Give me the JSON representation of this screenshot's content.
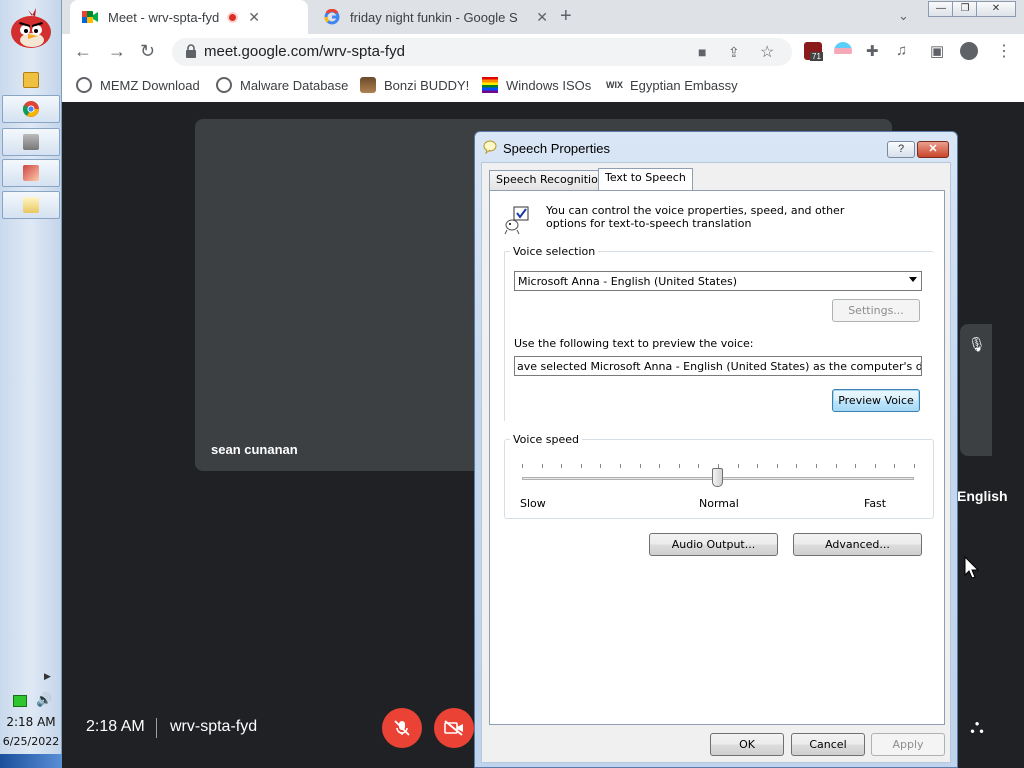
{
  "taskbar": {
    "time": "2:18 AM",
    "date": "6/25/2022"
  },
  "browser": {
    "tabs": [
      {
        "title": "Meet - wrv-spta-fyd",
        "active": true,
        "recording": true
      },
      {
        "title": "friday night funkin - Google S",
        "active": false
      }
    ],
    "url": "meet.google.com/wrv-spta-fyd",
    "extension_badge": "71",
    "bookmarks": [
      {
        "label": "MEMZ Download",
        "icon": "globe-icon"
      },
      {
        "label": "Malware Database",
        "icon": "globe-icon"
      },
      {
        "label": "Bonzi BUDDY!",
        "icon": "bonzi-icon"
      },
      {
        "label": "Windows ISOs",
        "icon": "rainbow-icon"
      },
      {
        "label": "Egyptian Embassy",
        "icon": "wix-icon"
      }
    ]
  },
  "meet": {
    "participant_name": "sean cunanan",
    "caption_fragment": "English",
    "time": "2:18 AM",
    "meeting_code": "wrv-spta-fyd"
  },
  "dialog": {
    "title": "Speech Properties",
    "help_label": "?",
    "close_label": "✕",
    "tabs": [
      "Speech Recognition",
      "Text to Speech"
    ],
    "active_tab": "Text to Speech",
    "intro_text": "You can control the voice properties, speed, and other options for text-to-speech translation",
    "voice_selection_label": "Voice selection",
    "selected_voice": "Microsoft Anna - English (United States)",
    "settings_button": "Settings...",
    "preview_label": "Use the following text to preview the voice:",
    "preview_text": "ave selected Microsoft Anna - English (United States) as the computer's default voice.",
    "preview_button": "Preview Voice",
    "voice_speed_label": "Voice speed",
    "speed_slow": "Slow",
    "speed_normal": "Normal",
    "speed_fast": "Fast",
    "speed_value": 0.5,
    "audio_output_button": "Audio Output...",
    "advanced_button": "Advanced...",
    "ok_button": "OK",
    "cancel_button": "Cancel",
    "apply_button": "Apply"
  },
  "colors": {
    "meet_bg": "#202124",
    "tile_bg": "#3c4043",
    "danger": "#ea4335"
  }
}
